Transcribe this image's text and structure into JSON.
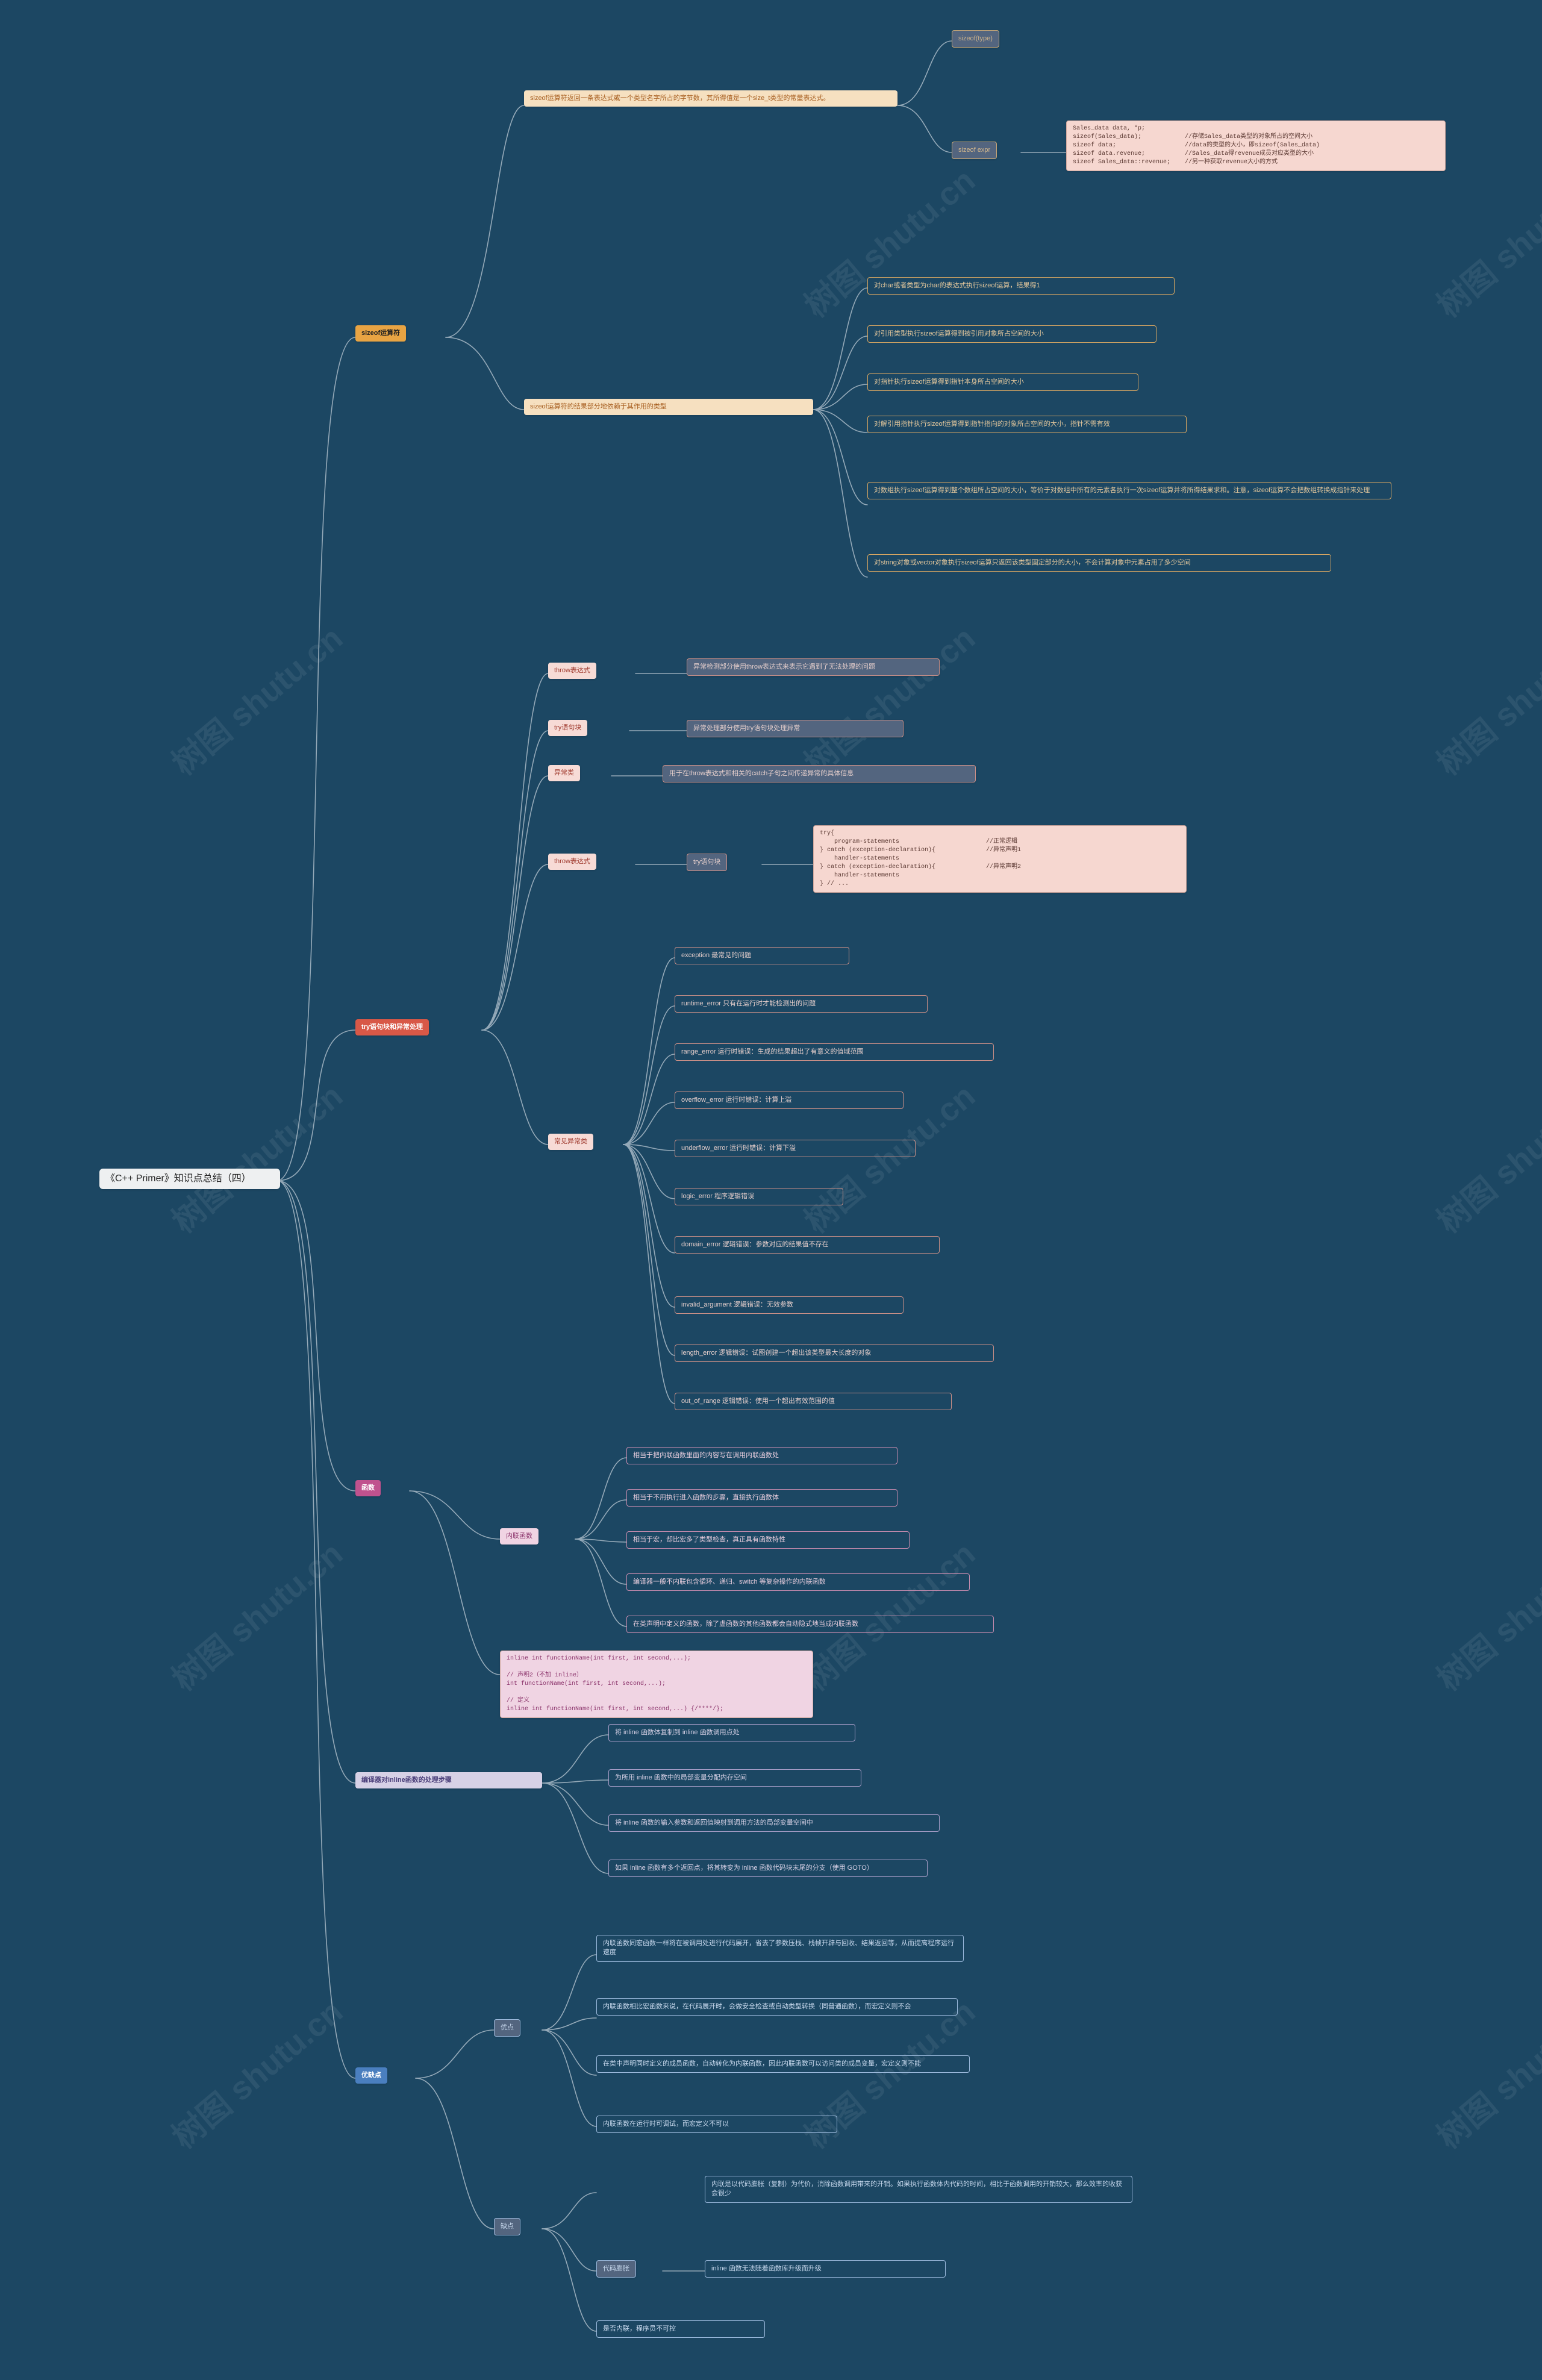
{
  "root": "《C++ Primer》知识点总结（四）",
  "watermark": "树图 shutu.cn",
  "sizeof": {
    "label": "sizeof运算符",
    "desc": "sizeof运算符返回一条表达式或一个类型名字所占的字节数，其所得值是一个size_t类型的常量表达式。",
    "form1": "sizeof(type)",
    "form2": "sizeof expr",
    "code": "Sales_data data, *p;\nsizeof(Sales_data);            //存储Sales_data类型的对象所占的空间大小\nsizeof data;                   //data的类型的大小，即sizeof(Sales_data)\nsizeof data.revenue;           //Sales_data得revenue成员对应类型的大小\nsizeof Sales_data::revenue;    //另一种获取revenue大小的方式",
    "resultLabel": "sizeof运算符的结果部分地依赖于其作用的类型",
    "r1": "对char或者类型为char的表达式执行sizeof运算，结果得1",
    "r2": "对引用类型执行sizeof运算得到被引用对象所占空间的大小",
    "r3": "对指针执行sizeof运算得到指针本身所占空间的大小",
    "r4": "对解引用指针执行sizeof运算得到指针指向的对象所占空间的大小，指针不需有效",
    "r5": "对数组执行sizeof运算得到整个数组所占空间的大小，等价于对数组中所有的元素各执行一次sizeof运算并将所得结果求和。注意，sizeof运算不会把数组转换成指针来处理",
    "r6": "对string对象或vector对象执行sizeof运算只返回该类型固定部分的大小，不会计算对象中元素占用了多少空间"
  },
  "try": {
    "label": "try语句块和异常处理",
    "throwExpr": "throw表达式",
    "throwExprDesc": "异常检测部分使用throw表达式来表示它遇到了无法处理的问题",
    "tryBlock": "try语句块",
    "tryBlockDesc": "异常处理部分使用try语句块处理异常",
    "excClass": "异常类",
    "excClassDesc": "用于在throw表达式和相关的catch子句之间传递异常的具体信息",
    "throwExpr2": "throw表达式",
    "tryBlock2": "try语句块",
    "code": "try{\n    program-statements                        //正常逻辑\n} catch (exception-declaration){              //异常声明1\n    handler-statements\n} catch (exception-declaration){              //异常声明2\n    handler-statements\n} // ...",
    "common": "常见异常类",
    "e1": "exception 最常见的问题",
    "e2": "runtime_error 只有在运行时才能检测出的问题",
    "e3": "range_error 运行时错误：生成的结果超出了有意义的值域范围",
    "e4": "overflow_error 运行时错误：计算上溢",
    "e5": "underflow_error 运行时错误：计算下溢",
    "e6": "logic_error 程序逻辑错误",
    "e7": "domain_error 逻辑错误：参数对应的结果值不存在",
    "e8": "invalid_argument 逻辑错误：无效参数",
    "e9": "length_error 逻辑错误：试图创建一个超出该类型最大长度的对象",
    "e10": "out_of_range 逻辑错误：使用一个超出有效范围的值"
  },
  "func": {
    "label": "函数",
    "inline": "内联函数",
    "i1": "相当于把内联函数里面的内容写在调用内联函数处",
    "i2": "相当于不用执行进入函数的步骤，直接执行函数体",
    "i3": "相当于宏，却比宏多了类型检查，真正具有函数特性",
    "i4": "编译器一般不内联包含循环、递归、switch 等复杂操作的内联函数",
    "i5": "在类声明中定义的函数，除了虚函数的其他函数都会自动隐式地当成内联函数",
    "code": "inline int functionName(int first, int second,...);\n\n// 声明2（不加 inline）\nint functionName(int first, int second,...);\n\n// 定义\ninline int functionName(int first, int second,...) {/****/};"
  },
  "compiler": {
    "label": "编译器对inline函数的处理步骤",
    "s1": "将 inline 函数体复制到 inline 函数调用点处",
    "s2": "为所用 inline 函数中的局部变量分配内存空间",
    "s3": "将 inline 函数的输入参数和返回值映射到调用方法的局部变量空间中",
    "s4": "如果 inline 函数有多个返回点，将其转变为 inline 函数代码块末尾的分支（使用 GOTO）"
  },
  "proscons": {
    "label": "优缺点",
    "pros": "优点",
    "cons": "缺点",
    "p1": "内联函数同宏函数一样将在被调用处进行代码展开，省去了参数压栈、栈帧开辟与回收、结果返回等，从而提高程序运行速度",
    "p2": "内联函数相比宏函数来说，在代码展开时，会做安全检查或自动类型转换（同普通函数），而宏定义则不会",
    "p3": "在类中声明同时定义的成员函数，自动转化为内联函数，因此内联函数可以访问类的成员变量，宏定义则不能",
    "p4": "内联函数在运行时可调试，而宏定义不可以",
    "c0": "代码膨胀",
    "c1": "内联是以代码膨胀（复制）为代价，消除函数调用带来的开销。如果执行函数体内代码的时间，相比于函数调用的开销较大，那么效率的收获会很少",
    "c2": "inline 函数无法随着函数库升级而升级",
    "c3": "是否内联，程序员不可控"
  }
}
